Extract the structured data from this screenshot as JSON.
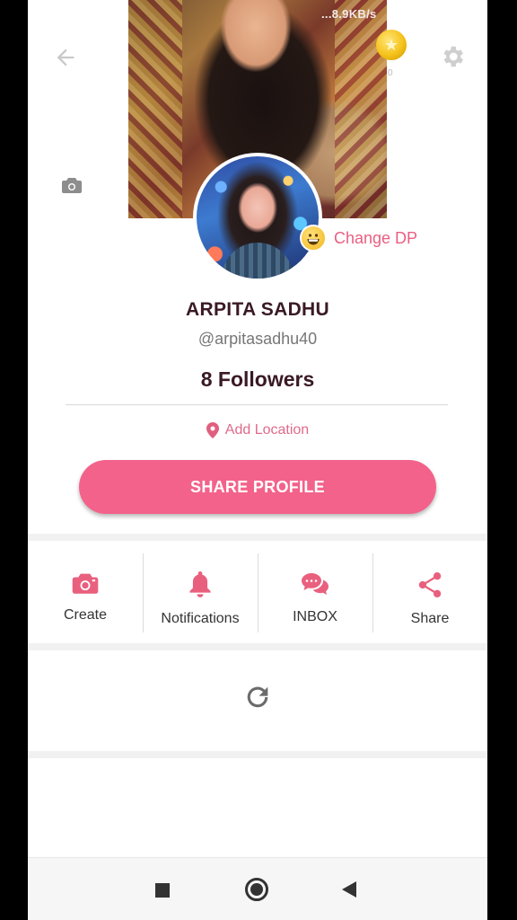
{
  "status": {
    "net_speed": "...8.9KB/s"
  },
  "header": {
    "coin_count": "0"
  },
  "profile": {
    "change_dp_label": "Change DP",
    "name": "ARPITA SADHU",
    "handle": "@arpitasadhu40",
    "followers": "8 Followers",
    "location_label": "Add Location",
    "share_label": "SHARE PROFILE"
  },
  "actions": [
    {
      "label": "Create",
      "icon": "camera-icon"
    },
    {
      "label": "Notifications",
      "icon": "bell-icon"
    },
    {
      "label": "INBOX",
      "icon": "chat-icon"
    },
    {
      "label": "Share",
      "icon": "share-icon"
    }
  ],
  "colors": {
    "accent": "#f3628a",
    "accent_text": "#e95f82",
    "name_text": "#3a1a24"
  }
}
